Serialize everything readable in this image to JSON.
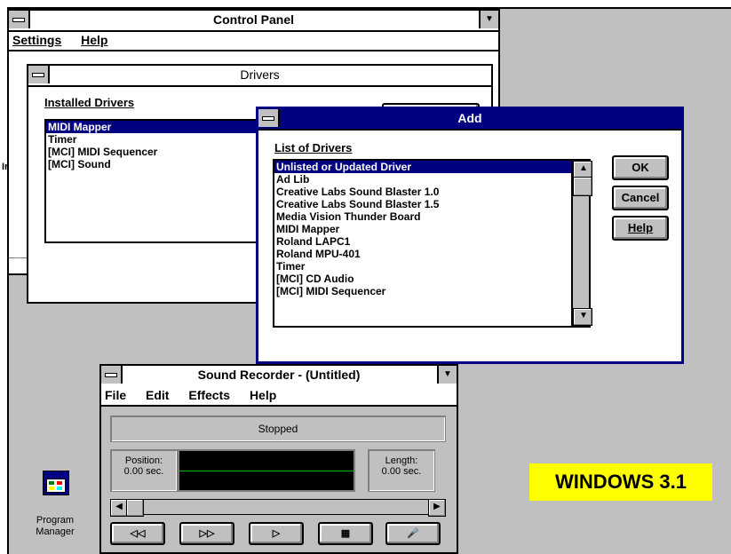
{
  "control_panel": {
    "title": "Control Panel",
    "menu": [
      "Settings",
      "Help"
    ]
  },
  "drivers": {
    "title": "Drivers",
    "installed_label": "Installed Drivers",
    "items": [
      "MIDI Mapper",
      "Timer",
      "[MCI] MIDI Sequencer",
      "[MCI] Sound"
    ],
    "selected_index": 0,
    "partial_text": "Ir"
  },
  "add_dialog": {
    "title": "Add",
    "list_label": "List of Drivers",
    "items": [
      "Unlisted or Updated Driver",
      "Ad Lib",
      "Creative Labs Sound Blaster 1.0",
      "Creative Labs Sound Blaster 1.5",
      "Media Vision Thunder Board",
      "MIDI Mapper",
      "Roland LAPC1",
      "Roland MPU-401",
      "Timer",
      "[MCI] CD Audio",
      "[MCI] MIDI Sequencer"
    ],
    "selected_index": 0,
    "buttons": {
      "ok": "OK",
      "cancel": "Cancel",
      "help": "Help"
    }
  },
  "sound_recorder": {
    "title": "Sound Recorder - (Untitled)",
    "menu": [
      "File",
      "Edit",
      "Effects",
      "Help"
    ],
    "status": "Stopped",
    "position_label": "Position:",
    "position_value": "0.00 sec.",
    "length_label": "Length:",
    "length_value": "0.00 sec.",
    "buttons": [
      "rewind",
      "fast-forward",
      "play",
      "stop",
      "record"
    ]
  },
  "program_manager": {
    "label_line1": "Program",
    "label_line2": "Manager"
  },
  "banner": {
    "text": "WINDOWS 3.1",
    "color": "#ffff00"
  }
}
